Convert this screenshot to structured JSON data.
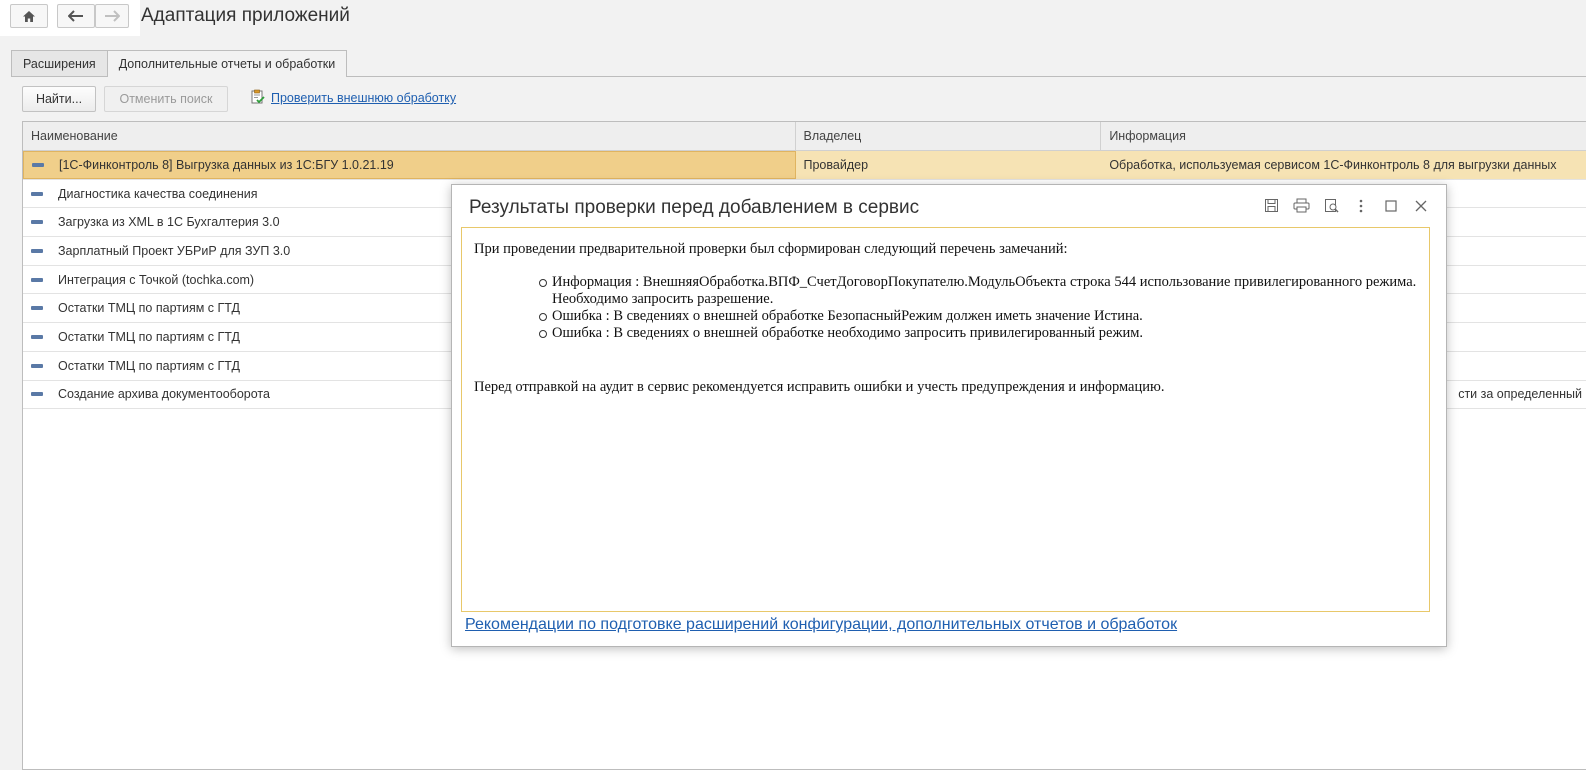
{
  "header": {
    "title": "Адаптация приложений"
  },
  "tabs": [
    {
      "label": "Расширения"
    },
    {
      "label": "Дополнительные отчеты и обработки"
    }
  ],
  "toolbar": {
    "find_label": "Найти...",
    "cancel_search_label": "Отменить поиск",
    "check_external_label": "Проверить внешнюю обработку"
  },
  "table": {
    "columns": [
      "Наименование",
      "Владелец",
      "Информация"
    ],
    "rows": [
      {
        "name": "[1С-Финконтроль 8] Выгрузка данных из 1С:БГУ 1.0.21.19",
        "owner": "Провайдер",
        "info": "Обработка, используемая сервисом 1С-Финконтроль 8 для выгрузки данных"
      },
      {
        "name": "Диагностика качества соединения",
        "owner": "",
        "info": ""
      },
      {
        "name": "Загрузка из XML в 1С Бухгалтерия 3.0",
        "owner": "",
        "info": ""
      },
      {
        "name": "Зарплатный Проект УБРиР для ЗУП 3.0",
        "owner": "",
        "info": ""
      },
      {
        "name": "Интеграция с Точкой (tochka.com)",
        "owner": "",
        "info": ""
      },
      {
        "name": "Остатки ТМЦ по партиям с ГТД",
        "owner": "",
        "info": ""
      },
      {
        "name": "Остатки ТМЦ по партиям с ГТД",
        "owner": "",
        "info": ""
      },
      {
        "name": "Остатки ТМЦ по партиям с ГТД",
        "owner": "",
        "info": ""
      },
      {
        "name": "Создание архива документооборота",
        "owner": "",
        "info": "сти за определенный"
      }
    ]
  },
  "modal": {
    "title": "Результаты проверки перед добавлением в сервис",
    "intro": "При проведении предварительной проверки был сформирован следующий перечень замечаний:",
    "items": [
      "Информация : ВнешняяОбработка.ВПФ_СчетДоговорПокупателю.МодульОбъекта строка 544 использование привилегированного режима. Необходимо запросить разрешение.",
      "Ошибка : В сведениях о внешней обработке БезопасныйРежим должен иметь значение Истина.",
      "Ошибка : В сведениях о внешней обработке необходимо запросить привилегированный режим."
    ],
    "closing": "Перед отправкой на аудит в сервис рекомендуется исправить ошибки и учесть предупреждения и информацию.",
    "link": "Рекомендации по подготовке расширений конфигурации, дополнительных отчетов и обработок"
  },
  "icons": {
    "home": "home-icon",
    "back": "arrow-left-icon",
    "forward": "arrow-right-icon",
    "check": "clipboard-check-icon",
    "save": "save-icon",
    "print": "print-icon",
    "preview": "preview-icon",
    "more": "more-vertical-icon",
    "maximize": "maximize-icon",
    "close": "close-icon"
  },
  "colors": {
    "selection": "#f0cf8a",
    "link": "#1f5fb0",
    "accent_border": "#e8c86a"
  }
}
